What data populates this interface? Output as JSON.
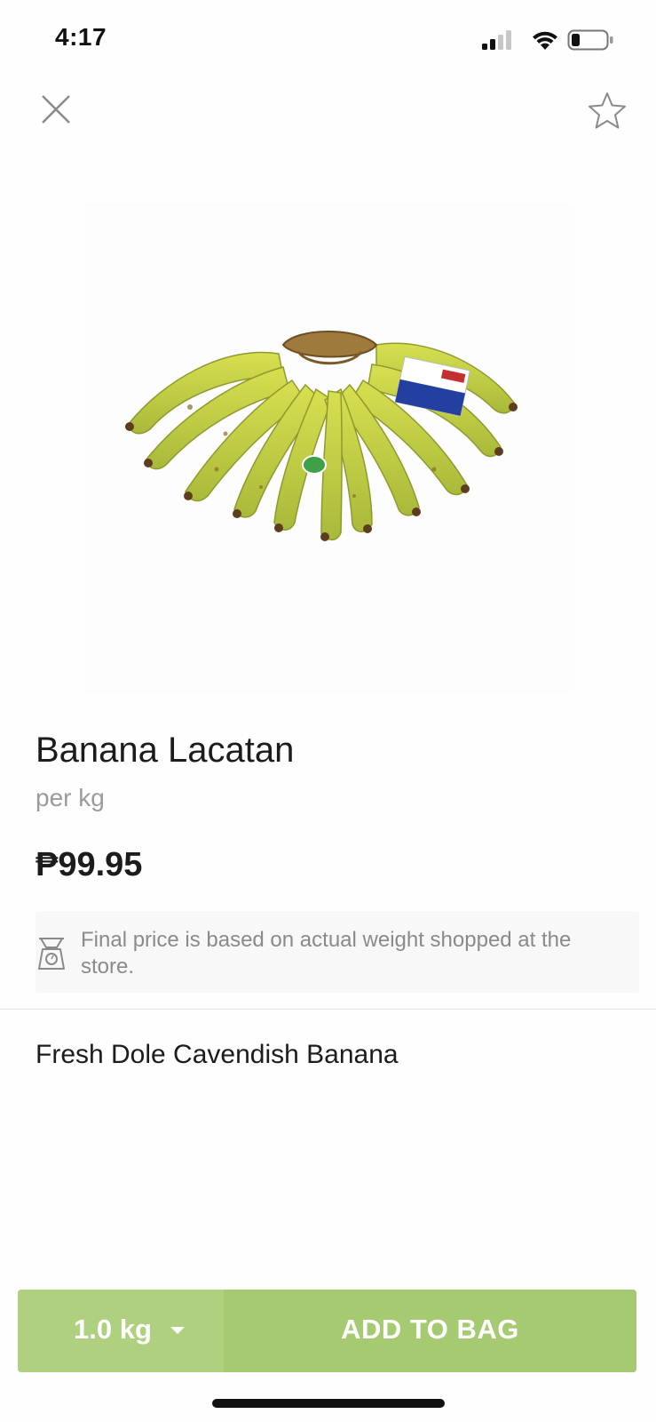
{
  "status_bar": {
    "time": "4:17",
    "icons": [
      "cellular-signal-icon",
      "wifi-icon",
      "battery-icon"
    ]
  },
  "nav": {
    "close_icon": "close-icon",
    "favorite_icon": "star-outline-icon"
  },
  "product": {
    "image_icon": "banana-bunch-image",
    "name": "Banana Lacatan",
    "unit": "per kg",
    "price": "₱99.95",
    "notice_icon": "weighing-scale-icon",
    "notice_text": "Final price is based on actual weight shopped at the store.",
    "description": "Fresh Dole Cavendish Banana"
  },
  "action_bar": {
    "quantity": "1.0 kg",
    "quantity_caret_icon": "caret-down-icon",
    "add_label": "ADD TO BAG"
  },
  "colors": {
    "accent_green": "#a6ca72",
    "quantity_green": "#afd17f",
    "text_primary": "#1c1c1c",
    "text_secondary": "#9b9b9b"
  }
}
